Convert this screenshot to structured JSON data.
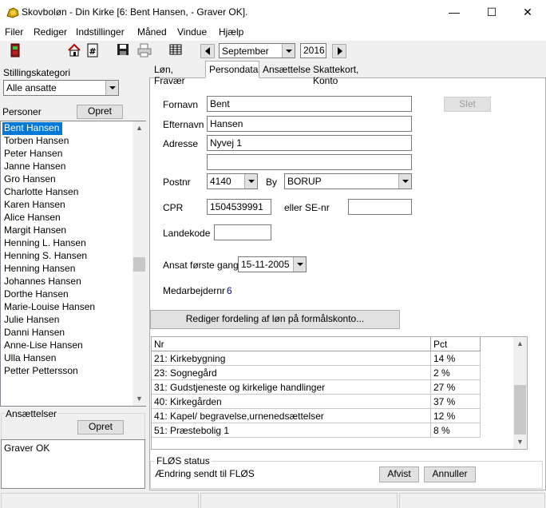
{
  "window": {
    "title": "Skovboløn - Din Kirke [6: Bent Hansen, - Graver OK].",
    "minimize": "—",
    "maximize": "☐",
    "close": "✕"
  },
  "menu": [
    "Filer",
    "Rediger",
    "Indstillinger",
    "Måned",
    "Vindue",
    "Hjælp"
  ],
  "toolbar": {
    "month": "September",
    "year": "2016",
    "icons": [
      "exit-icon",
      "home-icon",
      "hash-icon",
      "save-icon",
      "print-icon",
      "grid-icon"
    ]
  },
  "left": {
    "category_label": "Stillingskategori",
    "category_value": "Alle ansatte",
    "persons_label": "Personer",
    "opret_label": "Opret",
    "persons": [
      "Bent Hansen",
      "Torben Hansen",
      "Peter Hansen",
      "Janne Hansen",
      "Gro Hansen",
      "Charlotte Hansen",
      "Karen Hansen",
      "Alice Hansen",
      "Margit Hansen",
      "Henning L. Hansen",
      "Henning S. Hansen",
      "Henning Hansen",
      "Johannes Hansen",
      "Dorthe Hansen",
      "Marie-Louise Hansen",
      "Julie Hansen",
      "Danni Hansen",
      "Anne-Lise Hansen",
      "Ulla Hansen",
      "Petter Pettersson"
    ],
    "selected_person": "Bent Hansen",
    "employments_label": "Ansættelser",
    "employments_opret_label": "Opret",
    "employments": [
      "Graver OK"
    ]
  },
  "tabs": [
    "Løn, Fravær",
    "Persondata",
    "Ansættelse",
    "Skattekort, Konto"
  ],
  "active_tab": "Persondata",
  "form": {
    "fornavn_label": "Fornavn",
    "fornavn": "Bent",
    "efternavn_label": "Efternavn",
    "efternavn": "Hansen",
    "adresse_label": "Adresse",
    "adresse1": "Nyvej 1",
    "adresse2": "",
    "postnr_label": "Postnr",
    "postnr": "4140",
    "by_label": "By",
    "by": "BORUP",
    "cpr_label": "CPR",
    "cpr": "1504539991",
    "se_label": "eller SE-nr",
    "se": "",
    "landekode_label": "Landekode",
    "landekode": "",
    "ansat_label": "Ansat første gang",
    "ansat_date": "15-11-2005",
    "medarb_label": "Medarbejdernr",
    "medarb": "6",
    "slet_label": "Slet",
    "rediger_label": "Rediger fordeling af løn på formålskonto..."
  },
  "table": {
    "headers": [
      "Nr",
      "Pct"
    ],
    "rows": [
      [
        "21: Kirkebygning",
        "14 %"
      ],
      [
        "23: Sognegård",
        "2 %"
      ],
      [
        "31: Gudstjeneste og kirkelige handlinger",
        "27 %"
      ],
      [
        "40: Kirkegården",
        "37 %"
      ],
      [
        "41: Kapel/ begravelse,urnenedsættelser",
        "12 %"
      ],
      [
        "51: Præstebolig 1",
        "8 %"
      ]
    ]
  },
  "flos": {
    "label": "FLØS status",
    "status": "Ændring sendt til FLØS",
    "afvist_label": "Afvist",
    "annuller_label": "Annuller"
  }
}
